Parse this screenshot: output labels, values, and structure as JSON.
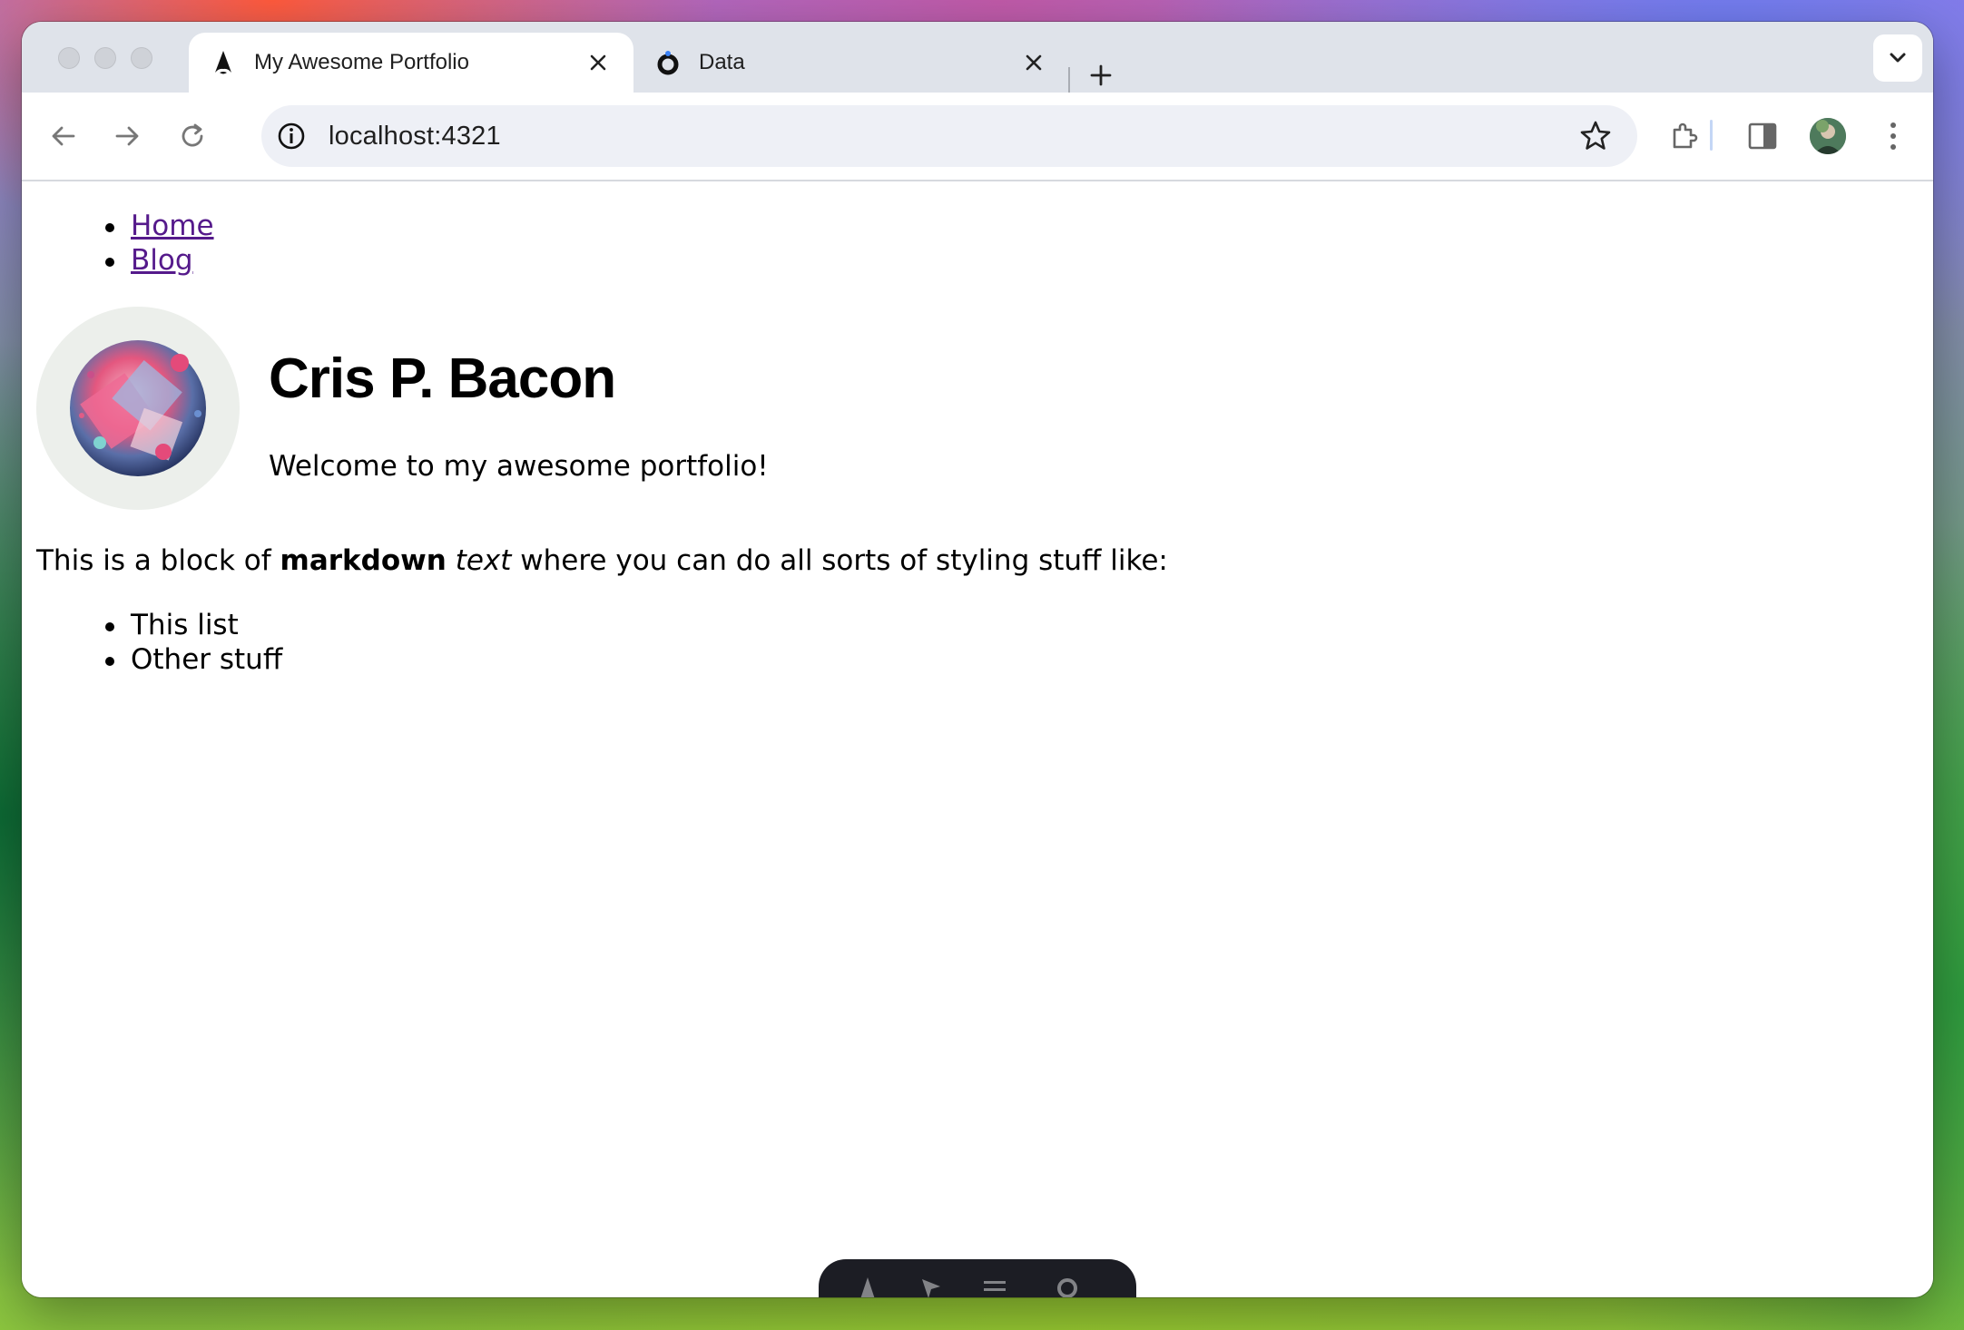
{
  "browser": {
    "tabs": [
      {
        "title": "My Awesome Portfolio",
        "favicon": "astro-icon",
        "active": true
      },
      {
        "title": "Data",
        "favicon": "data-icon",
        "active": false
      }
    ],
    "address": "localhost:4321"
  },
  "page": {
    "nav": [
      {
        "label": "Home"
      },
      {
        "label": "Blog"
      }
    ],
    "hero": {
      "name": "Cris P. Bacon",
      "tagline": "Welcome to my awesome portfolio!"
    },
    "markdown": {
      "prefix": "This is a block of ",
      "bold": "markdown",
      "space": " ",
      "italic": "text",
      "suffix": " where you can do all sorts of styling stuff like:",
      "items": [
        "This list",
        "Other stuff"
      ]
    }
  }
}
